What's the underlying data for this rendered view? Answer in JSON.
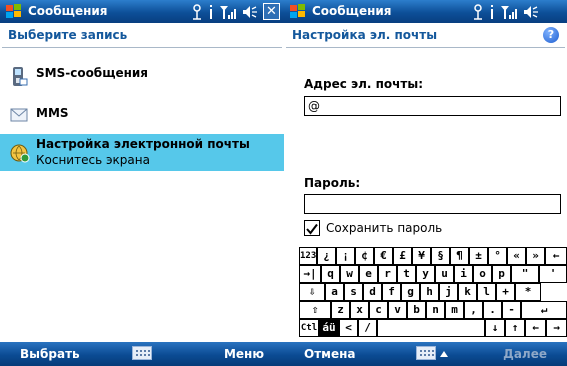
{
  "left": {
    "titlebar": {
      "title": "Сообщения",
      "close": "✕"
    },
    "header": "Выберите запись",
    "items": [
      {
        "title": "SMS-сообщения",
        "icon": "sms-icon"
      },
      {
        "title": "MMS",
        "icon": "mms-icon"
      },
      {
        "title": "Настройка электронной почты",
        "subtitle": "Коснитесь экрана",
        "icon": "email-setup-icon"
      }
    ],
    "softkeys": {
      "left": "Выбрать",
      "right": "Меню"
    }
  },
  "right": {
    "titlebar": {
      "title": "Сообщения"
    },
    "header": "Настройка эл. почты",
    "help": "?",
    "email_label": "Адрес эл. почты:",
    "email_value": "@",
    "password_label": "Пароль:",
    "password_value": "",
    "save_password_label": "Сохранить пароль",
    "save_password_checked": true,
    "softkeys": {
      "left": "Отмена",
      "right": "Далее"
    },
    "keyboard": {
      "rows": [
        [
          "123",
          "¿",
          "¡",
          "¢",
          "€",
          "£",
          "¥",
          "§",
          "¶",
          "±",
          "°",
          "«",
          "»",
          "←"
        ],
        [
          "→|",
          "q",
          "w",
          "e",
          "r",
          "t",
          "y",
          "u",
          "i",
          "o",
          "p",
          "\"",
          "'"
        ],
        [
          "⇩",
          "a",
          "s",
          "d",
          "f",
          "g",
          "h",
          "j",
          "k",
          "l",
          "+",
          "*"
        ],
        [
          "⇧",
          "z",
          "x",
          "c",
          "v",
          "b",
          "n",
          "m",
          ",",
          ".",
          "-",
          "↵"
        ],
        [
          "Ctl",
          "áü",
          "<",
          "/",
          "",
          "↓",
          "↑",
          "←",
          "→"
        ]
      ]
    }
  },
  "colors": {
    "titlebar": "#0d4f98",
    "selection": "#56c8ea",
    "header_text": "#14589c"
  }
}
